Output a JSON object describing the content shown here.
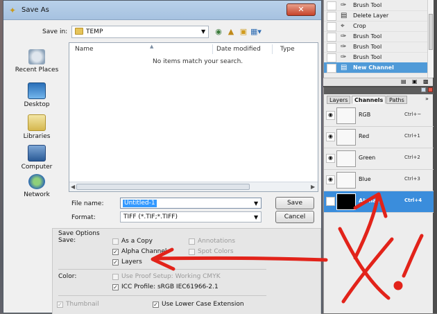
{
  "dialog": {
    "title": "Save As",
    "save_in_label": "Save in:",
    "save_in_value": "TEMP",
    "places": [
      {
        "label": "Recent Places",
        "icon": "recent-places-icon"
      },
      {
        "label": "Desktop",
        "icon": "desktop-icon"
      },
      {
        "label": "Libraries",
        "icon": "libraries-icon"
      },
      {
        "label": "Computer",
        "icon": "computer-icon"
      },
      {
        "label": "Network",
        "icon": "network-icon"
      }
    ],
    "columns": {
      "name": "Name",
      "date_modified": "Date modified",
      "type": "Type"
    },
    "empty_message": "No items match your search.",
    "file_name_label": "File name:",
    "file_name_value": "Untitled-1",
    "format_label": "Format:",
    "format_value": "TIFF (*.TIF;*.TIFF)",
    "save_button": "Save",
    "cancel_button": "Cancel",
    "options": {
      "title": "Save Options",
      "save_label": "Save:",
      "as_a_copy": "As a Copy",
      "annotations": "Annotations",
      "alpha_channels": "Alpha Channels",
      "spot_colors": "Spot Colors",
      "layers": "Layers",
      "color_label": "Color:",
      "use_proof_setup": "Use Proof Setup:  Working CMYK",
      "icc_profile": "ICC Profile:  sRGB IEC61966-2.1",
      "thumbnail": "Thumbnail",
      "use_lower_case": "Use Lower Case Extension"
    }
  },
  "history": {
    "items": [
      {
        "label": "Brush Tool",
        "icon": "brush-icon"
      },
      {
        "label": "Delete Layer",
        "icon": "delete-layer-icon"
      },
      {
        "label": "Crop",
        "icon": "crop-icon"
      },
      {
        "label": "Brush Tool",
        "icon": "brush-icon"
      },
      {
        "label": "Brush Tool",
        "icon": "brush-icon"
      },
      {
        "label": "Brush Tool",
        "icon": "brush-icon"
      },
      {
        "label": "New Channel",
        "icon": "new-channel-icon"
      }
    ]
  },
  "channels_panel": {
    "tabs": [
      "Layers",
      "Channels",
      "Paths"
    ],
    "channels": [
      {
        "name": "RGB",
        "shortcut": "Ctrl+~"
      },
      {
        "name": "Red",
        "shortcut": "Ctrl+1"
      },
      {
        "name": "Green",
        "shortcut": "Ctrl+2"
      },
      {
        "name": "Blue",
        "shortcut": "Ctrl+3"
      },
      {
        "name": "Alpha 1",
        "shortcut": "Ctrl+4"
      }
    ]
  },
  "colors": {
    "selection_blue": "#3a8ddc",
    "annotation_red": "#e2231a"
  }
}
